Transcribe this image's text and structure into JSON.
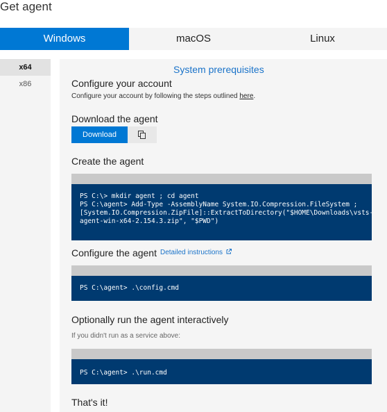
{
  "page_title": "Get agent",
  "os_tabs": [
    {
      "label": "Windows",
      "active": true
    },
    {
      "label": "macOS",
      "active": false
    },
    {
      "label": "Linux",
      "active": false
    }
  ],
  "arch_tabs": [
    {
      "label": "x64",
      "active": true
    },
    {
      "label": "x86",
      "active": false
    }
  ],
  "prereq_link": "System prerequisites",
  "sections": {
    "configure_account": {
      "heading": "Configure your account",
      "text_before": "Configure your account by following the steps outlined ",
      "link": "here",
      "text_after": "."
    },
    "download": {
      "heading": "Download the agent",
      "button_label": "Download"
    },
    "create": {
      "heading": "Create the agent",
      "code": "PS C:\\> mkdir agent ; cd agent\nPS C:\\agent> Add-Type -AssemblyName System.IO.Compression.FileSystem ;\n[System.IO.Compression.ZipFile]::ExtractToDirectory(\"$HOME\\Downloads\\vsts-\nagent-win-x64-2.154.3.zip\", \"$PWD\")"
    },
    "configure_agent": {
      "heading": "Configure the agent",
      "link": "Detailed instructions",
      "code": "PS C:\\agent> .\\config.cmd"
    },
    "run": {
      "heading": "Optionally run the agent interactively",
      "note": "If you didn't run as a service above:",
      "code": "PS C:\\agent> .\\run.cmd"
    },
    "done": {
      "heading": "That's it!"
    }
  },
  "colors": {
    "accent": "#0078d4",
    "code_bg": "#003a70",
    "link": "#1a73c9"
  },
  "icons": [
    "copy-icon",
    "external-link-icon"
  ]
}
